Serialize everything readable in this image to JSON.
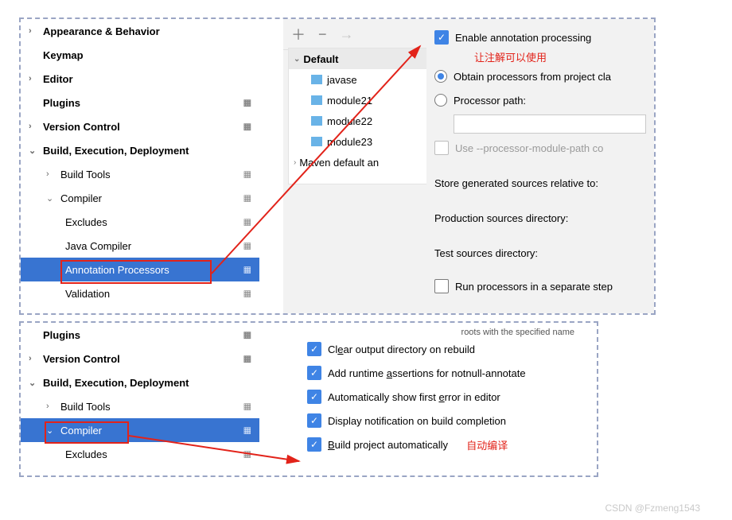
{
  "tree_top": {
    "appearance": "Appearance & Behavior",
    "keymap": "Keymap",
    "editor": "Editor",
    "plugins": "Plugins",
    "version_control": "Version Control",
    "bed": "Build, Execution, Deployment",
    "build_tools": "Build Tools",
    "compiler": "Compiler",
    "excludes": "Excludes",
    "java_compiler": "Java Compiler",
    "annotation_processors": "Annotation Processors",
    "validation": "Validation"
  },
  "tree_bottom": {
    "plugins": "Plugins",
    "version_control": "Version Control",
    "bed": "Build, Execution, Deployment",
    "build_tools": "Build Tools",
    "compiler": "Compiler",
    "excludes": "Excludes"
  },
  "subtree": {
    "default": "Default",
    "items": [
      "javase",
      "module21",
      "module22",
      "module23"
    ],
    "maven": "Maven default an"
  },
  "opts_top": {
    "enable": "Enable annotation processing",
    "note1": "让注解可以使用",
    "obtain": "Obtain processors from project cla",
    "proc_path": "Processor path:",
    "use_module_path": "Use --processor-module-path co",
    "store": "Store generated sources relative to:",
    "prod": "Production sources directory:",
    "test": "Test sources directory:",
    "run_sep": "Run processors in a separate step"
  },
  "opts_bottom": {
    "roots": "roots with the specified name",
    "clear": "Clear output directory on rebuild",
    "assertions": "Add runtime assertions for notnull-annotate",
    "auto_show": "Automatically show first error in editor",
    "notify": "Display notification on build completion",
    "build_auto": "Build project automatically",
    "note2": "自动编译"
  },
  "watermark": "CSDN @Fzmeng1543"
}
